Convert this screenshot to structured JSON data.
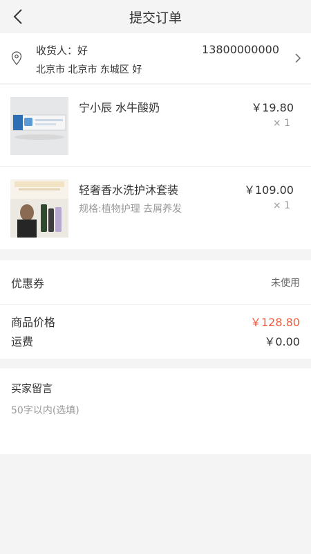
{
  "header": {
    "title": "提交订单"
  },
  "address": {
    "receiver": "收货人：好",
    "phone": "13800000000",
    "detail": "北京市 北京市 东城区 好"
  },
  "products": [
    {
      "name": "宁小辰 水牛酸奶",
      "spec": "",
      "price": "￥19.80",
      "qty": "× 1"
    },
    {
      "name": "轻奢香水洗护沐套装",
      "spec": "规格:植物护理 去屑养发",
      "price": "￥109.00",
      "qty": "× 1"
    }
  ],
  "coupon": {
    "label": "优惠券",
    "value": "未使用"
  },
  "pricing": {
    "goods_label": "商品价格",
    "goods_value": "￥128.80",
    "shipping_label": "运费",
    "shipping_value": "￥0.00"
  },
  "message": {
    "label": "买家留言",
    "placeholder": "50字以内(选填)"
  },
  "colors": {
    "accent": "#f05a3c",
    "background": "#f4f4f4"
  }
}
